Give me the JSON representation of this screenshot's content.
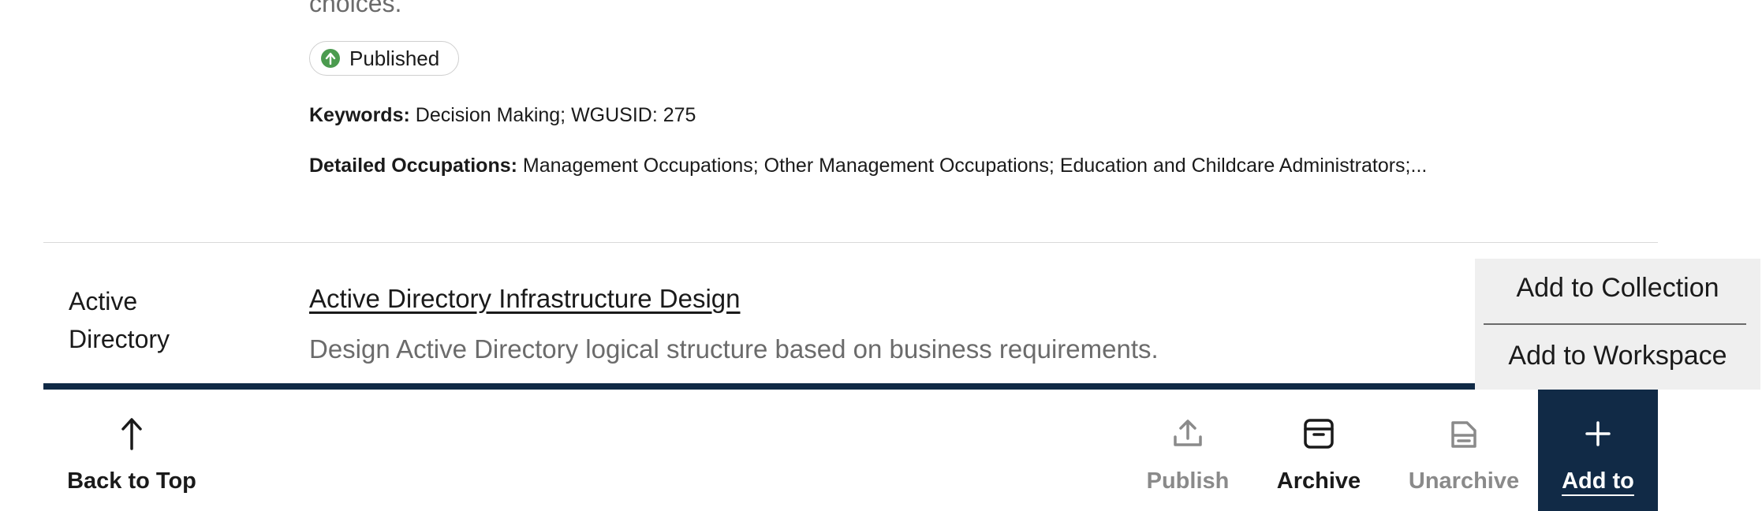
{
  "partial_text": "choices.",
  "status_badge": {
    "label": "Published",
    "color": "#4b9b4f"
  },
  "keywords": {
    "label": "Keywords:",
    "value": "Decision Making; WGUSID: 275"
  },
  "occupations": {
    "label": "Detailed Occupations:",
    "value": "Management Occupations; Other Management Occupations; Education and Childcare Administrators;..."
  },
  "item": {
    "category": "Active Directory",
    "title": "Active Directory Infrastructure Design",
    "description": "Design Active Directory logical structure based on business requirements."
  },
  "toolbar": {
    "back_to_top": "Back to Top",
    "publish": "Publish",
    "archive": "Archive",
    "unarchive": "Unarchive",
    "add_to": "Add to"
  },
  "add_menu": {
    "add_to_collection": "Add to Collection",
    "add_to_workspace": "Add to Workspace"
  },
  "colors": {
    "toolbar_accent": "#112a46",
    "muted_text": "#6b6b6b",
    "menu_bg": "#efefef"
  },
  "icons": [
    "arrow-up-icon",
    "upload-icon",
    "archive-box-icon",
    "unarchive-icon",
    "plus-icon",
    "check-up-arrow-icon"
  ]
}
